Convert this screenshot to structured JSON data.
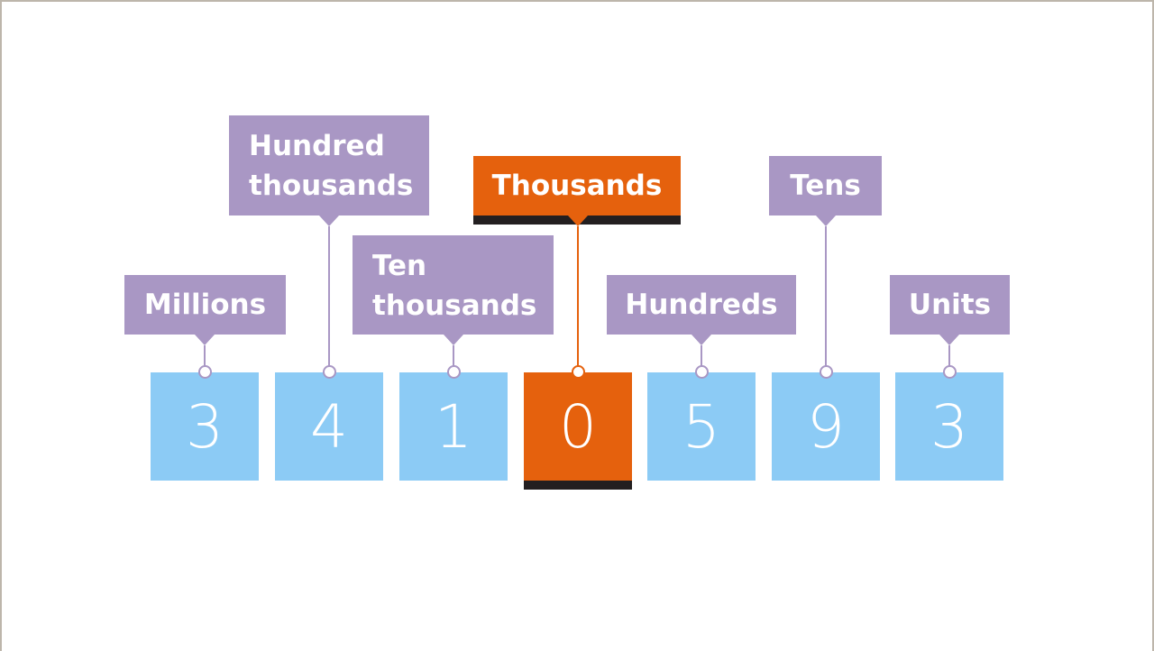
{
  "colors": {
    "label": "#a997c4",
    "digit": "#8ccbf5",
    "highlight": "#e5610d",
    "shadow": "#231f20"
  },
  "highlight_place": "Thousands",
  "places": [
    {
      "label": "Millions",
      "digit": "3"
    },
    {
      "label": "Hundred thousands",
      "digit": "4"
    },
    {
      "label": "Ten thousands",
      "digit": "1"
    },
    {
      "label": "Thousands",
      "digit": "0"
    },
    {
      "label": "Hundreds",
      "digit": "5"
    },
    {
      "label": "Tens",
      "digit": "9"
    },
    {
      "label": "Units",
      "digit": "3"
    }
  ]
}
